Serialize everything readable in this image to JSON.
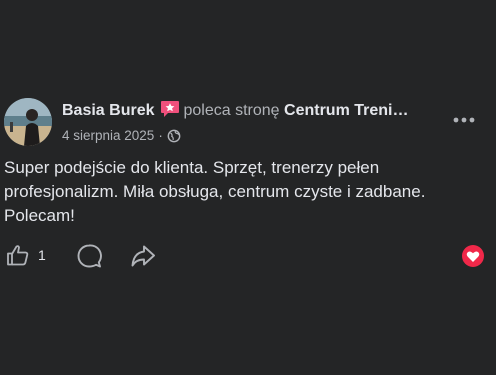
{
  "post": {
    "author": "Basia Burek",
    "verb": "poleca stronę",
    "page_name": "Centrum Treni…",
    "date": "4 sierpnia 2025",
    "separator": "·",
    "body": "Super podejście do klienta. Sprzęt, trenerzy pełen profesjonalizm. Miła obsługa, centrum czyste i zadbane. Polecam!",
    "like_count": "1"
  },
  "icons": {
    "badge": "recommend-badge-icon",
    "privacy": "globe-icon",
    "more": "more-dots-icon",
    "like": "thumbs-up-icon",
    "comment": "comment-bubble-icon",
    "share": "share-arrow-icon",
    "reaction": "heart-reaction-icon"
  },
  "colors": {
    "background": "#242526",
    "primary_text": "#e4e6eb",
    "secondary_text": "#b0b3b8",
    "badge_pink": "#f0507c",
    "heart_red": "#f02849"
  }
}
